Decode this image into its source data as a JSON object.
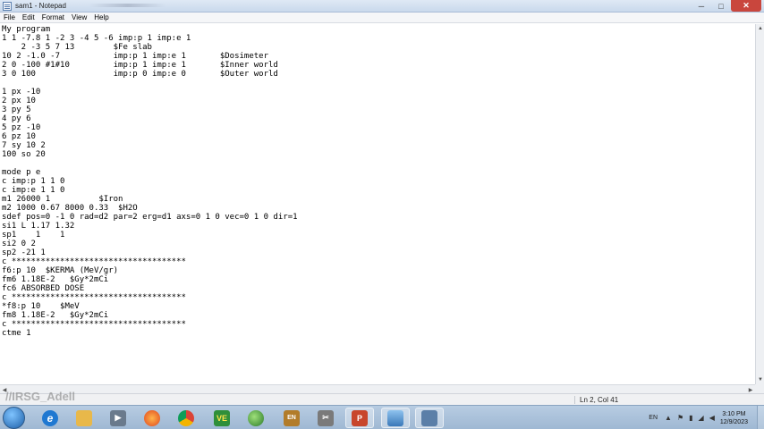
{
  "window": {
    "title": "sam1 - Notepad",
    "minimize": "─",
    "maximize": "□",
    "close": "✕"
  },
  "menu": [
    {
      "label": "File"
    },
    {
      "label": "Edit"
    },
    {
      "label": "Format"
    },
    {
      "label": "View"
    },
    {
      "label": "Help"
    }
  ],
  "editor": {
    "content": "My program\n1 1 -7.8 1 -2 3 -4 5 -6 imp:p 1 imp:e 1\n    2 -3 5 7 13        $Fe slab\n10 2 -1.0 -7           imp:p 1 imp:e 1       $Dosimeter\n2 0 -100 #1#10         imp:p 1 imp:e 1       $Inner world\n3 0 100                imp:p 0 imp:e 0       $Outer world\n\n1 px -10\n2 px 10\n3 py 5\n4 py 6\n5 pz -10\n6 pz 10\n7 sy 10 2\n100 so 20\n\nmode p e\nc imp:p 1 1 0\nc imp:e 1 1 0\nm1 26000 1          $Iron\nm2 1000 0.67 8000 0.33  $H2O\nsdef pos=0 -1 0 rad=d2 par=2 erg=d1 axs=0 1 0 vec=0 1 0 dir=1\nsi1 L 1.17 1.32\nsp1    1    1\nsi2 0 2\nsp2 -21 1\nc ************************************\nf6:p 10  $KERMA (MeV/gr)\nfm6 1.18E-2   $Gy*2mCi\nfc6 ABSORBED DOSE\nc ************************************\n*f8:p 10    $MeV\nfm8 1.18E-2   $Gy*2mCi\nc ************************************\nctme 1"
  },
  "status": {
    "position": "Ln 2, Col 41"
  },
  "watermark": "//IRSG_Adell",
  "taskbar": {
    "language": "EN",
    "time": "3:10 PM",
    "date": "12/9/2023",
    "apps": [
      {
        "name": "ie",
        "glyph": "e",
        "color": "#1f78d1"
      },
      {
        "name": "explorer",
        "glyph": "",
        "color": "#e8b84a"
      },
      {
        "name": "media",
        "glyph": "▶",
        "color": "#6a7a8c"
      },
      {
        "name": "firefox",
        "glyph": "",
        "color": "#e66a1f"
      },
      {
        "name": "chrome",
        "glyph": "",
        "color": "#3aa757"
      },
      {
        "name": "ve",
        "glyph": "VE",
        "color": "#2f8f3a"
      },
      {
        "name": "globe",
        "glyph": "",
        "color": "#3d9a3d"
      },
      {
        "name": "dictionary",
        "glyph": "EN",
        "color": "#b27c2a"
      },
      {
        "name": "tools",
        "glyph": "✂",
        "color": "#7a7a7a"
      },
      {
        "name": "powerpoint",
        "glyph": "P",
        "color": "#c8462c"
      },
      {
        "name": "display",
        "glyph": "",
        "color": "#4b8ac4"
      },
      {
        "name": "notepad",
        "glyph": "",
        "color": "#5b7fa8"
      }
    ]
  }
}
